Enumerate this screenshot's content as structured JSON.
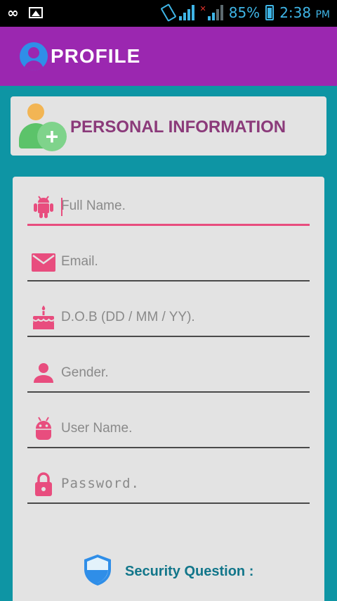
{
  "status_bar": {
    "battery_percent": "85%",
    "time": "2:38",
    "time_suffix": "PM"
  },
  "app_bar": {
    "title": "PROFILE",
    "icon": "account-circle-icon"
  },
  "header": {
    "title": "PERSONAL INFORMATION",
    "icon": "add-user-icon"
  },
  "form": {
    "fields": [
      {
        "icon": "android-icon",
        "placeholder": "Full Name.",
        "value": ""
      },
      {
        "icon": "mail-icon",
        "placeholder": "Email.",
        "value": ""
      },
      {
        "icon": "cake-icon",
        "placeholder": "D.O.B (DD / MM / YY).",
        "value": ""
      },
      {
        "icon": "person-icon",
        "placeholder": "Gender.",
        "value": ""
      },
      {
        "icon": "android-head-icon",
        "placeholder": "User Name.",
        "value": ""
      },
      {
        "icon": "lock-icon",
        "placeholder": "Password.",
        "value": ""
      }
    ],
    "security_label": "Security Question :"
  },
  "colors": {
    "app_bar": "#9b27b0",
    "background": "#0e95a4",
    "accent": "#e84d7e",
    "header_text": "#8b3a7a",
    "security_text": "#12768a"
  }
}
